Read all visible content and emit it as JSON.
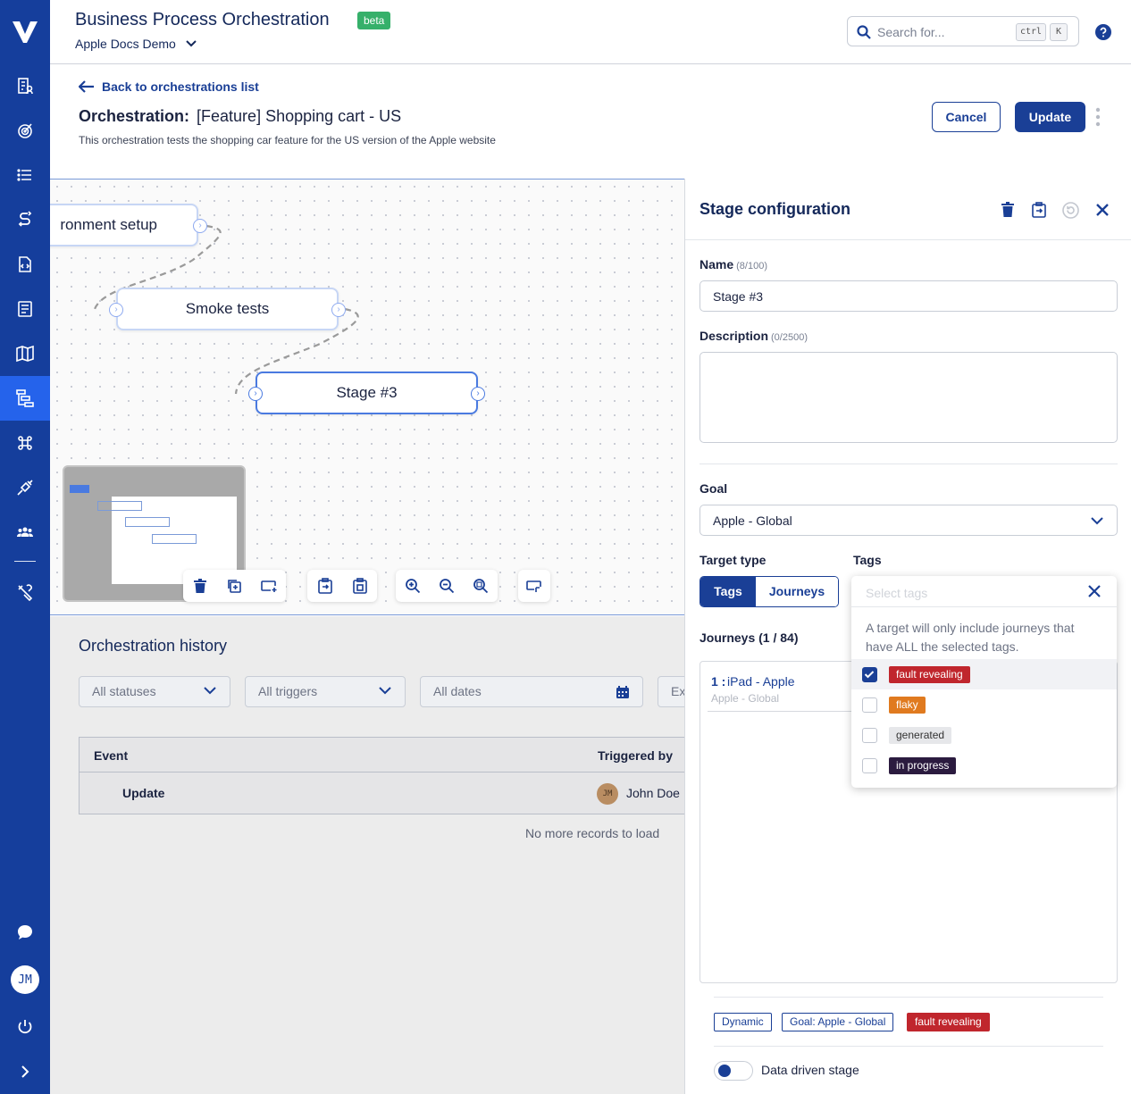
{
  "app": {
    "title": "Business Process Orchestration",
    "badge": "beta",
    "workspace": "Apple Docs Demo"
  },
  "search": {
    "placeholder": "Search for...",
    "key1": "ctrl",
    "key2": "K"
  },
  "page": {
    "back_label": "Back to orchestrations list",
    "title_prefix": "Orchestration:",
    "title": "[Feature] Shopping cart - US",
    "description": "This orchestration tests the shopping car feature for the US version of the Apple website",
    "cancel_label": "Cancel",
    "update_label": "Update"
  },
  "canvas": {
    "nodes": [
      "ronment setup",
      "Smoke tests",
      "Stage #3"
    ]
  },
  "history": {
    "title": "Orchestration history",
    "filters": [
      "All statuses",
      "All triggers",
      "All dates",
      "Ex"
    ],
    "columns": [
      "Event",
      "Triggered by"
    ],
    "rows": [
      {
        "event": "Update",
        "avatar": "JM",
        "user": "John Doe"
      }
    ],
    "footer": "No more records to load"
  },
  "panel": {
    "title": "Stage configuration",
    "name_label": "Name",
    "name_count": "(8/100)",
    "name_value": "Stage #3",
    "desc_label": "Description",
    "desc_count": "(0/2500)",
    "goal_label": "Goal",
    "goal_value": "Apple - Global",
    "target_type_label": "Target type",
    "tags_label": "Tags",
    "seg_tags": "Tags",
    "seg_journeys": "Journeys",
    "journeys_label": "Journeys (1 / 84)",
    "journey_num": "1 :",
    "journey_name": "iPad - Apple",
    "journey_goal": "Apple - Global",
    "chips": [
      {
        "label": "Dynamic"
      },
      {
        "label": "Goal: Apple - Global"
      },
      {
        "label": "fault revealing"
      }
    ],
    "toggle_label": "Data driven stage"
  },
  "tag_dropdown": {
    "placeholder": "Select tags",
    "info": "A target will only include journeys that have ALL the selected tags.",
    "options": [
      {
        "label": "fault revealing",
        "checked": true,
        "color": "#c0262d"
      },
      {
        "label": "flaky",
        "checked": false,
        "color": "#e07a1f"
      },
      {
        "label": "generated",
        "checked": false,
        "color": "#e6e7ea"
      },
      {
        "label": "in progress",
        "checked": false,
        "color": "#2b1b3f"
      }
    ]
  },
  "sidebar": {
    "user_initials": "JM"
  },
  "colors": {
    "brand": "#153e9c",
    "primary": "#1a3f96",
    "success": "#36b06a",
    "danger": "#c0262d"
  }
}
